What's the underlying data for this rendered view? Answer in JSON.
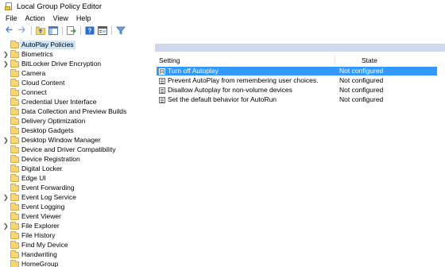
{
  "window": {
    "title": "Local Group Policy Editor"
  },
  "menu": [
    "File",
    "Action",
    "View",
    "Help"
  ],
  "toolbar": {
    "buttons": [
      "back-arrow-icon",
      "forward-arrow-icon",
      "up-folder-icon",
      "show-hide-tree-icon",
      "export-list-icon",
      "help-icon",
      "properties-icon",
      "filter-icon"
    ]
  },
  "tree": {
    "items": [
      {
        "label": "AutoPlay Policies",
        "expandable": false,
        "selected": true
      },
      {
        "label": "Biometrics",
        "expandable": true
      },
      {
        "label": "BitLocker Drive Encryption",
        "expandable": true
      },
      {
        "label": "Camera",
        "expandable": false
      },
      {
        "label": "Cloud Content",
        "expandable": false
      },
      {
        "label": "Connect",
        "expandable": false
      },
      {
        "label": "Credential User Interface",
        "expandable": false
      },
      {
        "label": "Data Collection and Preview Builds",
        "expandable": false
      },
      {
        "label": "Delivery Optimization",
        "expandable": false
      },
      {
        "label": "Desktop Gadgets",
        "expandable": false
      },
      {
        "label": "Desktop Window Manager",
        "expandable": true
      },
      {
        "label": "Device and Driver Compatibility",
        "expandable": false
      },
      {
        "label": "Device Registration",
        "expandable": false
      },
      {
        "label": "Digital Locker",
        "expandable": false
      },
      {
        "label": "Edge UI",
        "expandable": false
      },
      {
        "label": "Event Forwarding",
        "expandable": false
      },
      {
        "label": "Event Log Service",
        "expandable": true
      },
      {
        "label": "Event Logging",
        "expandable": false
      },
      {
        "label": "Event Viewer",
        "expandable": false
      },
      {
        "label": "File Explorer",
        "expandable": true
      },
      {
        "label": "File History",
        "expandable": false
      },
      {
        "label": "Find My Device",
        "expandable": false
      },
      {
        "label": "Handwriting",
        "expandable": false
      },
      {
        "label": "HomeGroup",
        "expandable": false
      }
    ]
  },
  "list": {
    "headers": {
      "setting": "Setting",
      "state": "State"
    },
    "rows": [
      {
        "name": "Turn off Autoplay",
        "state": "Not configured",
        "selected": true
      },
      {
        "name": "Prevent AutoPlay from remembering user choices.",
        "state": "Not configured"
      },
      {
        "name": "Disallow Autoplay for non-volume devices",
        "state": "Not configured"
      },
      {
        "name": "Set the default behavior for AutoRun",
        "state": "Not configured"
      }
    ]
  }
}
